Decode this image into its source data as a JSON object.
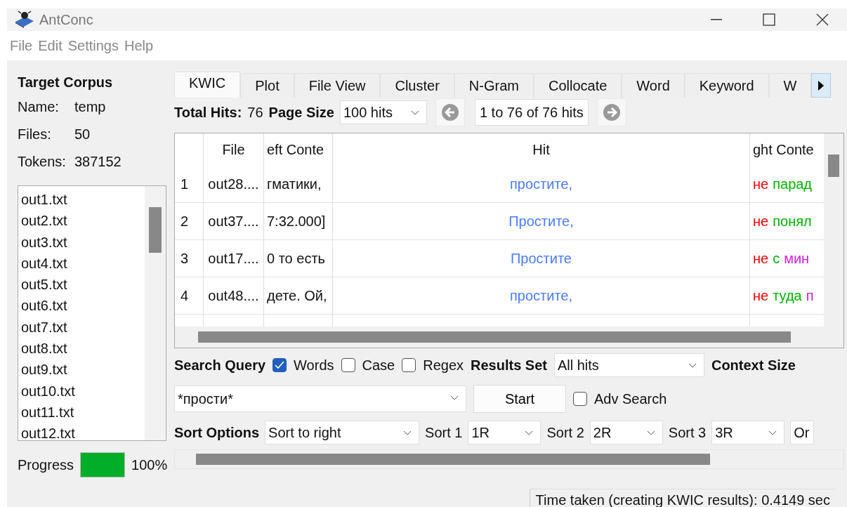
{
  "window": {
    "title": "AntConc"
  },
  "menu": [
    "File",
    "Edit",
    "Settings",
    "Help"
  ],
  "corpus": {
    "heading": "Target Corpus",
    "fields": [
      {
        "label": "Name:",
        "value": "temp"
      },
      {
        "label": "Files:",
        "value": "50"
      },
      {
        "label": "Tokens:",
        "value": "387152"
      }
    ],
    "files": [
      "out1.txt",
      "out2.txt",
      "out3.txt",
      "out4.txt",
      "out5.txt",
      "out6.txt",
      "out7.txt",
      "out8.txt",
      "out9.txt",
      "out10.txt",
      "out11.txt",
      "out12.txt"
    ],
    "progress": {
      "label": "Progress",
      "level": 1,
      "reading": "100%"
    }
  },
  "tabs": [
    {
      "label": "KWIC",
      "selected": true
    },
    {
      "label": "Plot",
      "selected": false
    },
    {
      "label": "File View",
      "selected": false
    },
    {
      "label": "Cluster",
      "selected": false
    },
    {
      "label": "N-Gram",
      "selected": false
    },
    {
      "label": "Collocate",
      "selected": false
    },
    {
      "label": "Word",
      "selected": false
    },
    {
      "label": "Keyword",
      "selected": false
    },
    {
      "label": "W",
      "selected": false
    }
  ],
  "hits_bar": {
    "total_label": "Total Hits:",
    "total": "76",
    "page_size_label": "Page Size",
    "page_size": "100 hits",
    "range": "1 to 76 of 76 hits"
  },
  "table": {
    "columns": [
      "File",
      "eft Conte",
      "Hit",
      "ght Conte"
    ],
    "rows": [
      {
        "num": "1",
        "file": "out28....",
        "left": "гматики,",
        "hit": "простите,",
        "right": [
          {
            "text": "не",
            "color": "#ff0000"
          },
          {
            "text": "парад",
            "color": "#00b400"
          }
        ]
      },
      {
        "num": "2",
        "file": "out37....",
        "left": "7:32.000]",
        "hit": "Простите,",
        "right": [
          {
            "text": "не",
            "color": "#ff0000"
          },
          {
            "text": "понял",
            "color": "#00b400"
          }
        ]
      },
      {
        "num": "3",
        "file": "out17....",
        "left": "0 то есть",
        "hit": "Простите",
        "right": [
          {
            "text": "не",
            "color": "#ff0000"
          },
          {
            "text": "с",
            "color": "#00b400"
          },
          {
            "text": "мин",
            "color": "#d020d0"
          }
        ]
      },
      {
        "num": "4",
        "file": "out48....",
        "left": "дете. Ой,",
        "hit": "простите,",
        "right": [
          {
            "text": "не",
            "color": "#ff0000"
          },
          {
            "text": "туда",
            "color": "#00b400"
          },
          {
            "text": "п",
            "color": "#d020d0"
          }
        ]
      }
    ]
  },
  "search": {
    "label": "Search Query",
    "options": [
      {
        "label": "Words",
        "checked": true
      },
      {
        "label": "Case",
        "checked": false
      },
      {
        "label": "Regex",
        "checked": false
      }
    ],
    "results_set_label": "Results Set",
    "results_set": "All hits",
    "context_size_label": "Context Size",
    "query": "*прости*",
    "start": "Start",
    "adv": {
      "label": "Adv Search",
      "checked": false
    }
  },
  "sort": {
    "label": "Sort Options",
    "mode": "Sort to right",
    "levels": [
      {
        "label": "Sort 1",
        "value": "1R"
      },
      {
        "label": "Sort 2",
        "value": "2R"
      },
      {
        "label": "Sort 3",
        "value": "3R"
      }
    ],
    "extra": "Or"
  },
  "status_bar": "Time taken (creating KWIC results):  0.4149 sec"
}
